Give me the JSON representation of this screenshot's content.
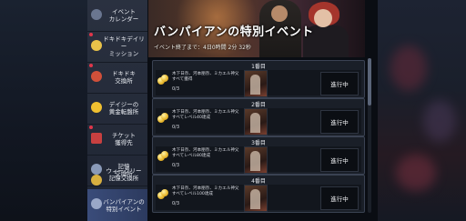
{
  "sidebar": {
    "items": [
      {
        "label": "イベント\nカレンダー",
        "icon": "calendar-icon",
        "active": false
      },
      {
        "label": "ドキドキデイリー\nミッション",
        "icon": "daily-mission-icon",
        "active": false
      },
      {
        "label": "ドキドキ\n交換所",
        "icon": "exchange-icon",
        "active": false
      },
      {
        "label": "デイジーの\n黄金転盤所",
        "icon": "gold-coin-icon",
        "active": false
      },
      {
        "label": "チケット\n獲得先",
        "icon": "ticket-icon",
        "active": false
      },
      {
        "label": "記憶\n交換所",
        "icon": "memory-icon",
        "active": false
      },
      {
        "label": "ウィークリー\n記憶交換所",
        "icon": "weekly-memory-icon",
        "active": false
      },
      {
        "label": "バンパイアンの\n特別イベント",
        "icon": "vampire-event-icon",
        "active": true
      }
    ]
  },
  "banner": {
    "title": "バンパイアンの特別イベント",
    "period": "イベント終了まで：4日0時間 2分 32秒"
  },
  "missions": [
    {
      "day": "1番目",
      "desc": "木下日奈、河本朋奈、ミカエル神父すべて獲得",
      "progress": "0/3",
      "status": "進行中"
    },
    {
      "day": "2番目",
      "desc": "木下日奈、河本朋奈、ミカエル神父すべてレベル40達成",
      "progress": "0/3",
      "status": "進行中"
    },
    {
      "day": "3番目",
      "desc": "木下日奈、河本朋奈、ミカエル神父すべてレベル80達成",
      "progress": "0/3",
      "status": "進行中"
    },
    {
      "day": "4番目",
      "desc": "木下日奈、河本朋奈、ミカエル神父すべてレベル100達成",
      "progress": "0/3",
      "status": "進行中"
    }
  ],
  "colors": {
    "active_tab": "#3a4c7a",
    "panel": "#1a1f28",
    "accent_gold": "#e6b52a"
  }
}
